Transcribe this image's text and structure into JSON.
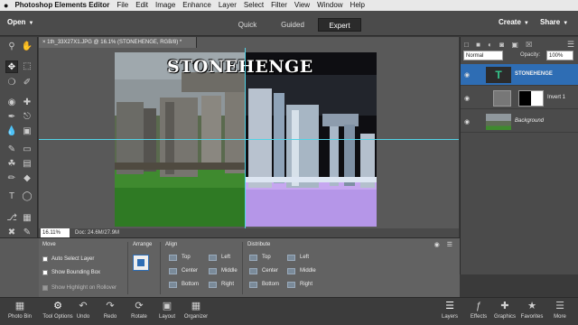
{
  "menubar": {
    "apple": "",
    "app": "Photoshop Elements Editor",
    "items": [
      "File",
      "Edit",
      "Image",
      "Enhance",
      "Layer",
      "Select",
      "Filter",
      "View",
      "Window",
      "Help"
    ]
  },
  "topbar": {
    "open_label": "Open",
    "modes": [
      "Quick",
      "Guided",
      "Expert"
    ],
    "active_mode": "Expert",
    "create_label": "Create",
    "share_label": "Share"
  },
  "document": {
    "tab_title": "× 1th_33X27X1.JPG @ 16.1% (STONEHENGE, RGB/8) *",
    "title_text": "STONEHENGE",
    "zoom": "16.11%",
    "doc_size": "Doc: 24.6M/27.9M"
  },
  "layers": {
    "blend_mode": "Normal",
    "opacity_label": "Opacity:",
    "opacity_value": "100%",
    "items": [
      {
        "name": "STONEHENGE",
        "type": "text"
      },
      {
        "name": "Invert 1",
        "type": "adjustment"
      },
      {
        "name": "Background",
        "type": "image"
      }
    ]
  },
  "options": {
    "move_heading": "Move",
    "auto_select": "Auto Select Layer",
    "bounding_box": "Show Bounding Box",
    "highlight": "Show Highlight on Rollover",
    "arrange_heading": "Arrange",
    "align_heading": "Align",
    "align_items": [
      "Top",
      "Left",
      "Center",
      "Middle",
      "Bottom",
      "Right"
    ],
    "distribute_heading": "Distribute",
    "distribute_items": [
      "Top",
      "Left",
      "Center",
      "Middle",
      "Bottom",
      "Right"
    ]
  },
  "taskbar": {
    "left_buttons": [
      {
        "label": "Photo Bin",
        "icon": "photo-bin-icon"
      },
      {
        "label": "Tool Options",
        "icon": "tool-options-icon"
      },
      {
        "label": "Undo",
        "icon": "undo-icon"
      },
      {
        "label": "Redo",
        "icon": "redo-icon"
      },
      {
        "label": "Rotate",
        "icon": "rotate-icon"
      },
      {
        "label": "Layout",
        "icon": "layout-icon"
      },
      {
        "label": "Organizer",
        "icon": "organizer-icon"
      }
    ],
    "right_buttons": [
      {
        "label": "Layers",
        "icon": "layers-icon"
      },
      {
        "label": "Effects",
        "icon": "effects-icon"
      },
      {
        "label": "Graphics",
        "icon": "graphics-icon"
      },
      {
        "label": "Favorites",
        "icon": "favorites-icon"
      },
      {
        "label": "More",
        "icon": "more-icon"
      }
    ]
  }
}
